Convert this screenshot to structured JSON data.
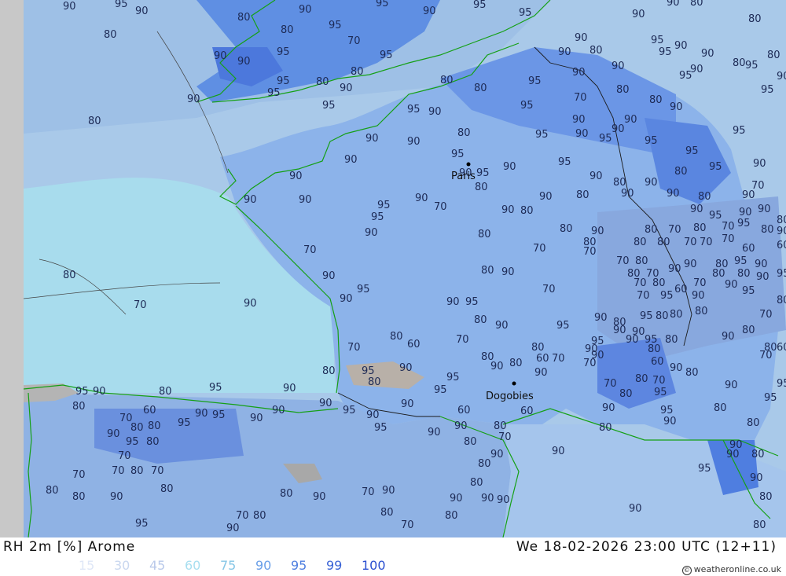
{
  "footer": {
    "title": "RH 2m [%] Arome",
    "time": "We 18-02-2026 23:00 UTC (12+11)",
    "credit": "© weatheronline.co.uk"
  },
  "legend": [
    {
      "label": "15",
      "color": "#dfe7f7"
    },
    {
      "label": "30",
      "color": "#c9d7ef"
    },
    {
      "label": "45",
      "color": "#b9c9ea"
    },
    {
      "label": "60",
      "color": "#a8dff0"
    },
    {
      "label": "75",
      "color": "#86c6e6"
    },
    {
      "label": "90",
      "color": "#6a9fe8"
    },
    {
      "label": "95",
      "color": "#4f7fe0"
    },
    {
      "label": "99",
      "color": "#3a64d6"
    },
    {
      "label": "100",
      "color": "#2a4fd0"
    }
  ],
  "cities": [
    {
      "name": "Paris"
    },
    {
      "name": "Dogobies"
    }
  ],
  "contour_labels": [
    "90",
    "95",
    "90",
    "80",
    "90",
    "95",
    "90",
    "95",
    "95",
    "90",
    "90",
    "80",
    "80",
    "80",
    "90",
    "90",
    "80",
    "95",
    "70",
    "95",
    "95",
    "80",
    "95",
    "80",
    "90",
    "95",
    "90",
    "80",
    "95",
    "95",
    "90",
    "80",
    "80",
    "95",
    "90",
    "90",
    "80",
    "90",
    "95",
    "90",
    "90",
    "95",
    "90",
    "95",
    "80",
    "80",
    "95",
    "90",
    "95",
    "90",
    "70",
    "80",
    "80",
    "90",
    "95",
    "90",
    "90",
    "90",
    "95",
    "95",
    "90",
    "95",
    "80",
    "90",
    "90",
    "90",
    "95",
    "90",
    "95",
    "90",
    "80",
    "95",
    "90",
    "80",
    "90",
    "95",
    "95",
    "80",
    "95",
    "90",
    "90",
    "90",
    "90",
    "95",
    "95",
    "90",
    "70",
    "90",
    "80",
    "90",
    "80",
    "90",
    "80",
    "90",
    "90",
    "80",
    "90",
    "70",
    "90",
    "95",
    "90",
    "90",
    "80",
    "90",
    "80",
    "70",
    "80",
    "70",
    "80",
    "70",
    "95",
    "80",
    "90",
    "80",
    "80",
    "80",
    "70",
    "70",
    "70",
    "60",
    "60",
    "70",
    "90",
    "95",
    "90",
    "90",
    "70",
    "80",
    "70",
    "80",
    "90",
    "70",
    "70",
    "80",
    "80",
    "70",
    "90",
    "90",
    "80",
    "95",
    "90",
    "95",
    "90",
    "80",
    "80",
    "70",
    "60",
    "80",
    "70",
    "70",
    "95",
    "90",
    "90",
    "95",
    "80",
    "90",
    "95",
    "80",
    "90",
    "95",
    "90",
    "80",
    "95",
    "80",
    "80",
    "80",
    "90",
    "90",
    "95",
    "95",
    "90",
    "80",
    "80",
    "90",
    "80",
    "70",
    "80",
    "60",
    "70",
    "80",
    "60",
    "70",
    "70",
    "80",
    "60",
    "70",
    "70",
    "90",
    "90",
    "60",
    "90",
    "80",
    "80",
    "90",
    "80",
    "90",
    "80",
    "95",
    "90",
    "80",
    "95",
    "95",
    "90",
    "90",
    "95",
    "80",
    "95",
    "90",
    "80",
    "90",
    "95",
    "90",
    "90",
    "90",
    "95",
    "90",
    "95",
    "90",
    "90",
    "80",
    "60",
    "80",
    "70",
    "60",
    "70",
    "80",
    "80",
    "70",
    "95",
    "90",
    "95",
    "90",
    "80",
    "80",
    "90",
    "95",
    "95",
    "80",
    "90",
    "90",
    "80",
    "90",
    "80",
    "80",
    "95",
    "90",
    "90",
    "90",
    "80",
    "80",
    "90",
    "90",
    "90",
    "80",
    "70",
    "80",
    "70",
    "90",
    "90",
    "80",
    "70",
    "80",
    "90",
    "95",
    "90",
    "80",
    "80",
    "70",
    "70",
    "80",
    "70",
    "80",
    "70",
    "95",
    "80",
    "90",
    "80",
    "80",
    "70",
    "60",
    "95"
  ]
}
